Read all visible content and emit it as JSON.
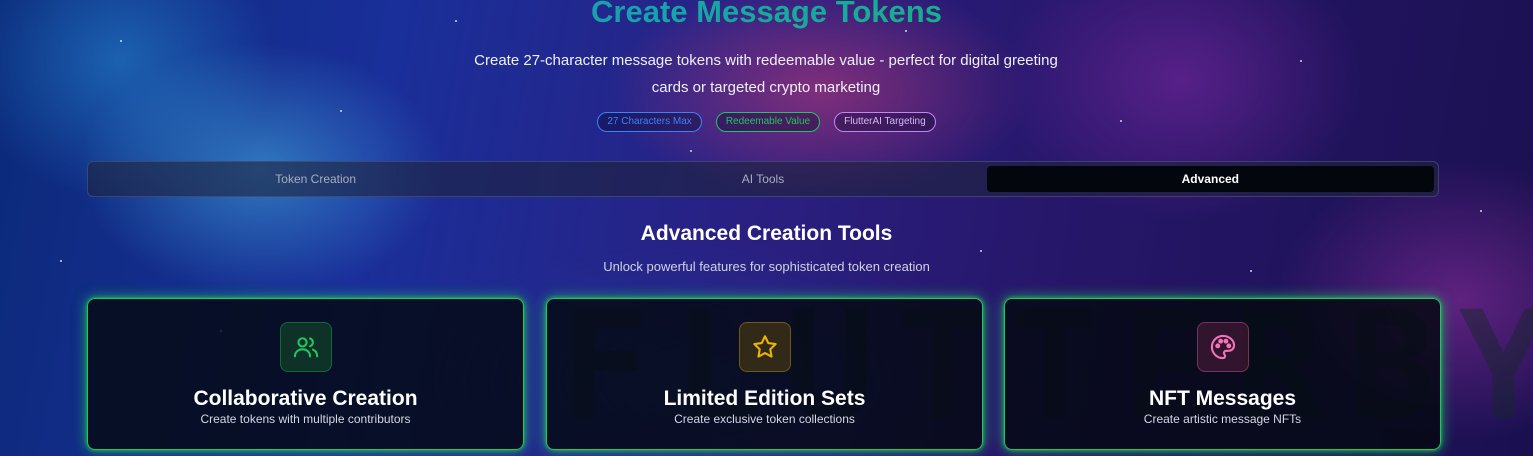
{
  "hero": {
    "title": "Create Message Tokens",
    "subtitle": "Create 27-character message tokens with redeemable value - perfect for digital greeting cards or targeted crypto marketing",
    "badges": [
      "27 Characters Max",
      "Redeemable Value",
      "FlutterAI Targeting"
    ]
  },
  "tabs": [
    {
      "label": "Token Creation",
      "active": false
    },
    {
      "label": "AI Tools",
      "active": false
    },
    {
      "label": "Advanced",
      "active": true
    }
  ],
  "section": {
    "title": "Advanced Creation Tools",
    "subtitle": "Unlock powerful features for sophisticated token creation"
  },
  "cards": [
    {
      "title": "Collaborative Creation",
      "description": "Create tokens with multiple contributors",
      "icon": "users-icon"
    },
    {
      "title": "Limited Edition Sets",
      "description": "Create exclusive token collections",
      "icon": "star-icon"
    },
    {
      "title": "NFT Messages",
      "description": "Create artistic message NFTs",
      "icon": "palette-icon"
    }
  ],
  "background": {
    "watermark": "FLUTTERBYE"
  },
  "colors": {
    "accent_green": "#22c55e",
    "accent_blue": "#3b82f6",
    "accent_purple": "#c084fc",
    "accent_yellow": "#eab308",
    "accent_pink": "#f472b6"
  }
}
